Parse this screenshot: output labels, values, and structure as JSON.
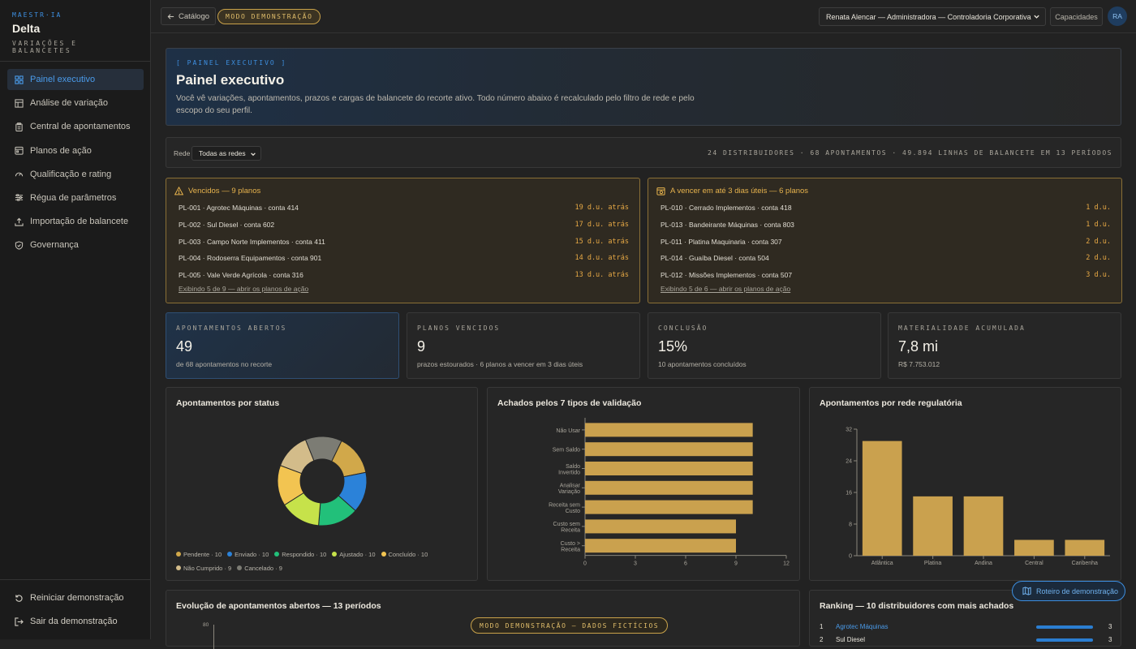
{
  "brand": {
    "kicker": "MAESTR·IA",
    "name": "Delta",
    "subtitle": "VARIAÇÕES E BALANCETES"
  },
  "sidebar": {
    "items": [
      {
        "label": "Painel executivo",
        "icon": "grid-icon",
        "active": true
      },
      {
        "label": "Análise de variação",
        "icon": "table-icon"
      },
      {
        "label": "Central de apontamentos",
        "icon": "clipboard-icon"
      },
      {
        "label": "Planos de ação",
        "icon": "calendar-icon"
      },
      {
        "label": "Qualificação e rating",
        "icon": "gauge-icon"
      },
      {
        "label": "Régua de parâmetros",
        "icon": "sliders-icon"
      },
      {
        "label": "Importação de balancete",
        "icon": "upload-icon"
      },
      {
        "label": "Governança",
        "icon": "shield-icon"
      }
    ],
    "bottom": [
      {
        "label": "Reiniciar demonstração",
        "icon": "reset-icon"
      },
      {
        "label": "Sair da demonstração",
        "icon": "logout-icon"
      }
    ]
  },
  "topbar": {
    "back_label": "Catálogo",
    "demo_badge": "MODO DEMONSTRAÇÃO",
    "user_selected": "Renata Alencar — Administradora — Controladoria Corporativa",
    "capabilities_label": "Capacidades",
    "avatar_initials": "RA"
  },
  "hero": {
    "kicker": "[ PAINEL EXECUTIVO ]",
    "title": "Painel executivo",
    "description": "Você vê variações, apontamentos, prazos e cargas de balancete do recorte ativo. Todo número abaixo é recalculado pelo filtro de rede e pelo escopo do seu perfil."
  },
  "filter": {
    "label": "Rede",
    "selected": "Todas as redes",
    "summary": "24 DISTRIBUIDORES · 68 APONTAMENTOS · 49.894 LINHAS DE BALANCETE EM 13 PERÍODOS"
  },
  "overdue": {
    "title": "Vencidos — 9 planos",
    "rows": [
      {
        "text": "PL-001 · Agrotec Máquinas · conta 414",
        "due": "19 d.u. atrás"
      },
      {
        "text": "PL-002 · Sul Diesel · conta 602",
        "due": "17 d.u. atrás"
      },
      {
        "text": "PL-003 · Campo Norte Implementos · conta 411",
        "due": "15 d.u. atrás"
      },
      {
        "text": "PL-004 · Rodoserra Equipamentos · conta 901",
        "due": "14 d.u. atrás"
      },
      {
        "text": "PL-005 · Vale Verde Agrícola · conta 316",
        "due": "13 d.u. atrás"
      }
    ],
    "more": "Exibindo 5 de 9 — abrir os planos de ação"
  },
  "upcoming": {
    "title": "A vencer em até 3 dias úteis — 6 planos",
    "rows": [
      {
        "text": "PL-010 · Cerrado Implementos · conta 418",
        "due": "1 d.u."
      },
      {
        "text": "PL-013 · Bandeirante Máquinas · conta 803",
        "due": "1 d.u."
      },
      {
        "text": "PL-011 · Platina Maquinaria · conta 307",
        "due": "2 d.u."
      },
      {
        "text": "PL-014 · Guaíba Diesel · conta 504",
        "due": "2 d.u."
      },
      {
        "text": "PL-012 · Missões Implementos · conta 507",
        "due": "3 d.u."
      }
    ],
    "more": "Exibindo 5 de 6 — abrir os planos de ação"
  },
  "kpis": [
    {
      "label": "APONTAMENTOS ABERTOS",
      "value": "49",
      "sub": "de 68 apontamentos no recorte"
    },
    {
      "label": "PLANOS VENCIDOS",
      "value": "9",
      "sub": "prazos estourados · 6 planos a vencer em 3 dias úteis"
    },
    {
      "label": "CONCLUSÃO",
      "value": "15%",
      "sub": "10 apontamentos concluídos"
    },
    {
      "label": "MATERIALIDADE ACUMULADA",
      "value": "7,8 mi",
      "sub": "R$ 7.753.012"
    }
  ],
  "chart_data": [
    {
      "type": "pie",
      "title": "Apontamentos por status",
      "labels": [
        "Pendente",
        "Enviado",
        "Respondido",
        "Ajustado",
        "Concluído",
        "Não Cumprido",
        "Cancelado"
      ],
      "values": [
        10,
        10,
        10,
        10,
        10,
        9,
        9
      ],
      "colors": [
        "#d1a84a",
        "#2b82d9",
        "#22c07a",
        "#c6e24a",
        "#f2c451",
        "#d3bc8a",
        "#7c7c74"
      ],
      "legend_suffix": [
        "Pendente · 10",
        "Enviado · 10",
        "Respondido · 10",
        "Ajustado · 10",
        "Concluído · 10",
        "Não Cumprido · 9",
        "Cancelado · 9"
      ]
    },
    {
      "type": "bar",
      "orientation": "horizontal",
      "title": "Achados pelos 7 tipos de validação",
      "categories": [
        "Não Usar",
        "Sem Saldo",
        "Saldo Invertido",
        "Analisar Variação",
        "Receita sem Custo",
        "Custo sem Receita",
        "Custo > Receita"
      ],
      "values": [
        10,
        10,
        10,
        10,
        10,
        9,
        9
      ],
      "xlim": [
        0,
        12
      ],
      "xticks": [
        "0",
        "3",
        "6",
        "9",
        "12"
      ],
      "color": "#caa14e"
    },
    {
      "type": "bar",
      "title": "Apontamentos por rede regulatória",
      "categories": [
        "Atlântica",
        "Platina",
        "Andina",
        "Central",
        "Caribenha"
      ],
      "values": [
        29,
        15,
        15,
        4,
        4
      ],
      "ylim": [
        0,
        32
      ],
      "yticks": [
        "0",
        "8",
        "16",
        "24",
        "32"
      ],
      "color": "#caa14e"
    }
  ],
  "bottom": {
    "evolution_title": "Evolução de apontamentos abertos — 13 períodos",
    "evolution_ytick": "80",
    "ranking_title": "Ranking — 10 distribuidores com mais achados",
    "ranking": [
      {
        "rank": "1",
        "name": "Agrotec Máquinas",
        "count": "3"
      },
      {
        "rank": "2",
        "name": "Sul Diesel",
        "count": "3"
      }
    ],
    "demo_float": "MODO DEMONSTRAÇÃO — DADOS FICTÍCIOS",
    "roteiro_label": "Roteiro de demonstração"
  }
}
